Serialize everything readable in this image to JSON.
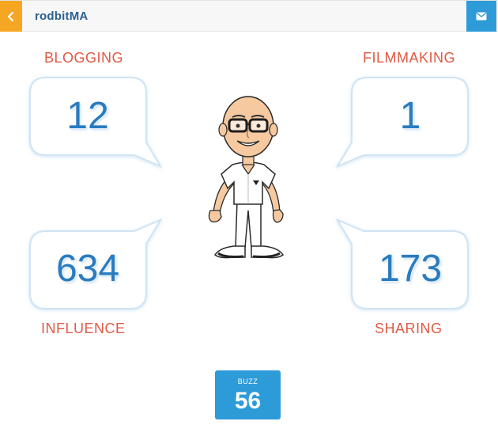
{
  "header": {
    "back_icon": "chevron-left-icon",
    "title": "rodbitMA",
    "mail_icon": "envelope-icon"
  },
  "stats": {
    "blogging": {
      "label": "BLOGGING",
      "value": "12"
    },
    "filmmaking": {
      "label": "FILMMAKING",
      "value": "1"
    },
    "influence": {
      "label": "INFLUENCE",
      "value": "634"
    },
    "sharing": {
      "label": "SHARING",
      "value": "173"
    }
  },
  "buzz": {
    "label": "BUZZ",
    "value": "56"
  },
  "colors": {
    "accent_orange": "#f5a623",
    "accent_blue": "#2d9bd8",
    "label_red": "#e05a45",
    "value_blue": "#2a7bbf",
    "title_blue": "#2b5f8f"
  }
}
